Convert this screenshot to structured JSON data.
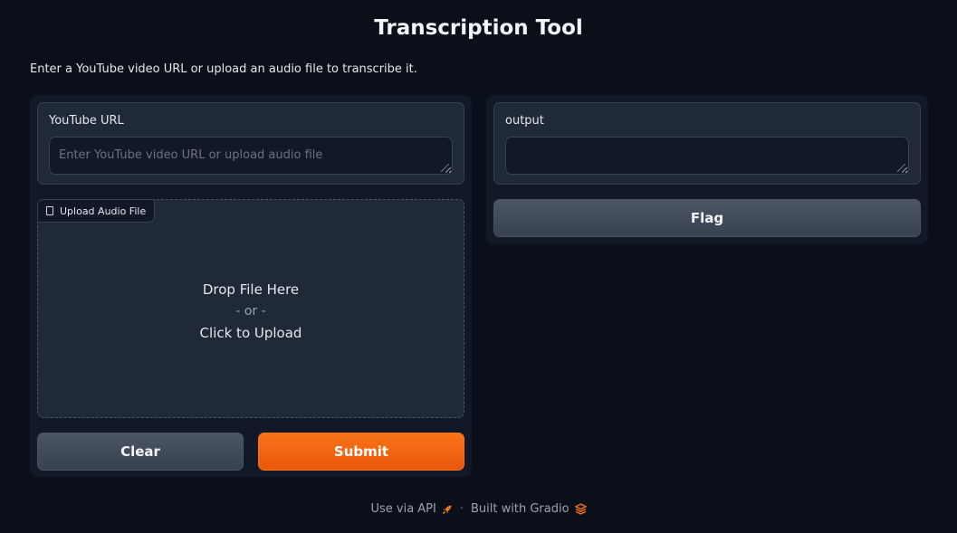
{
  "header": {
    "title": "Transcription Tool",
    "description": "Enter a YouTube video URL or upload an audio file to transcribe it."
  },
  "inputs": {
    "url_label": "YouTube URL",
    "url_placeholder": "Enter YouTube video URL or upload audio file",
    "url_value": "",
    "upload_label": "Upload Audio File",
    "upload_drop": "Drop File Here",
    "upload_or": "- or -",
    "upload_click": "Click to Upload"
  },
  "actions": {
    "clear_label": "Clear",
    "submit_label": "Submit",
    "flag_label": "Flag"
  },
  "outputs": {
    "output_label": "output",
    "output_value": ""
  },
  "footer": {
    "api_label": "Use via API",
    "separator": "·",
    "built_label": "Built with Gradio"
  },
  "colors": {
    "background": "#0b0f19",
    "panel": "#111827",
    "block": "#1f2937",
    "accent": "#f97316"
  },
  "icons": {
    "upload_tag": "file-icon",
    "api": "rocket-icon",
    "gradio": "gradio-logo-icon"
  }
}
